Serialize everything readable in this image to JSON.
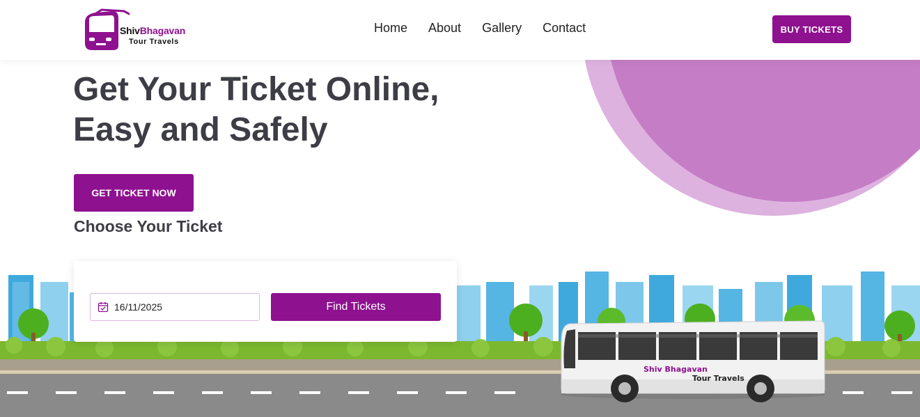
{
  "brand": {
    "name_part1": "Shiv",
    "name_part2": "Bhagavan",
    "tagline": "Tour Travels"
  },
  "nav": {
    "items": [
      {
        "label": "Home"
      },
      {
        "label": "About"
      },
      {
        "label": "Gallery"
      },
      {
        "label": "Contact"
      }
    ]
  },
  "header": {
    "buy_label": "BUY TICKETS"
  },
  "hero": {
    "title_line1": "Get Your Ticket Online,",
    "title_line2": "Easy and Safely",
    "cta_label": "GET TICKET NOW",
    "subheading": "Choose Your Ticket"
  },
  "booking": {
    "date_value": "16/11/2025",
    "find_label": "Find Tickets"
  },
  "bus": {
    "line1": "Shiv Bhagavan",
    "line2": "Tour Travels"
  },
  "colors": {
    "accent": "#8e118f",
    "circle": "#c57dc6",
    "circle_ring": "#ddb2df",
    "text": "#3d3d45"
  },
  "icons": {
    "date": "calendar-check-icon"
  }
}
